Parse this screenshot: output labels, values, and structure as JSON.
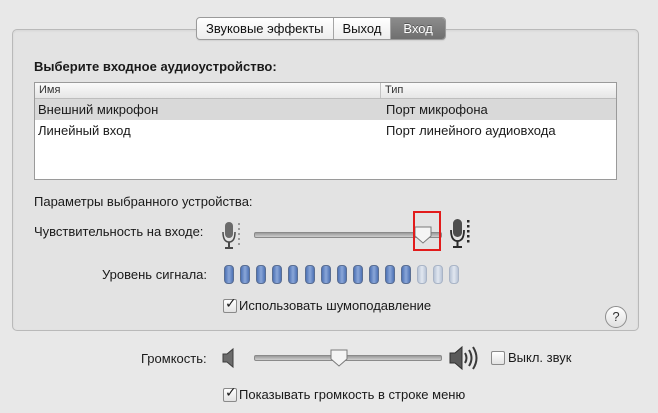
{
  "tabs": [
    {
      "label": "Звуковые эффекты",
      "active": false
    },
    {
      "label": "Выход",
      "active": false
    },
    {
      "label": "Вход",
      "active": true
    }
  ],
  "input": {
    "heading": "Выберите входное аудиоустройство:",
    "columns": [
      "Имя",
      "Тип"
    ],
    "devices": [
      {
        "name": "Внешний микрофон",
        "type": "Порт микрофона",
        "selected": true
      },
      {
        "name": "Линейный вход",
        "type": "Порт линейного аудиовхода",
        "selected": false
      }
    ],
    "settings_heading": "Параметры выбранного устройства:",
    "sensitivity_label": "Чувствительность на входе:",
    "sensitivity_level": 0.95,
    "level_label": "Уровень сигнала:",
    "level_segments_total": 15,
    "level_segments_lit": 12,
    "noise_reduction_label": "Использовать шумоподавление",
    "noise_reduction_checked": true,
    "help_label": "?"
  },
  "output": {
    "volume_label": "Громкость:",
    "volume_level": 0.45,
    "mute_label": "Выкл. звук",
    "mute_checked": false,
    "show_in_menu_label": "Показывать громкость в строке меню",
    "show_in_menu_checked": true
  },
  "colors": {
    "level_on": "#4f73b5",
    "level_off": "#d3dbe7",
    "highlight": "#e21b1b",
    "active_tab": "#7b7b7b"
  },
  "icons": [
    "mic-low-icon",
    "mic-high-icon",
    "speaker-low-icon",
    "speaker-high-icon",
    "checkmark-icon",
    "help-icon"
  ]
}
